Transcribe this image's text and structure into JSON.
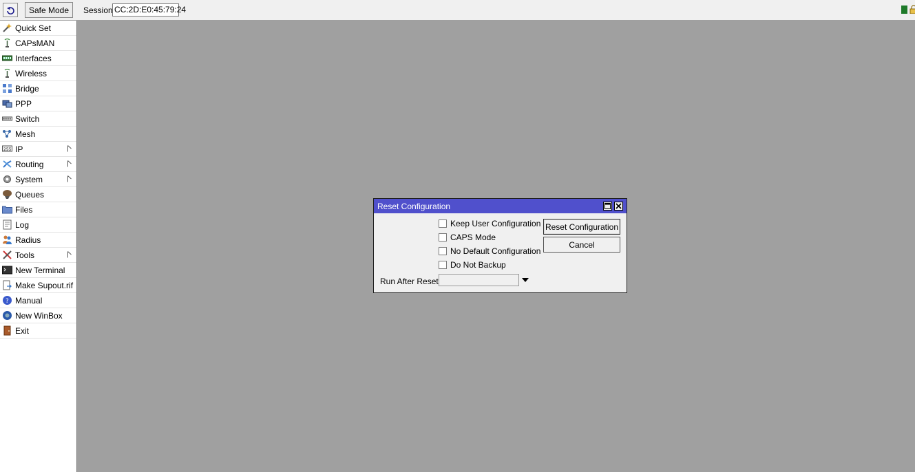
{
  "toolbar": {
    "safe_mode_label": "Safe Mode",
    "session_label": "Session:",
    "session_value": "CC:2D:E0:45:79:24"
  },
  "sidebar": {
    "items": [
      {
        "label": "Quick Set",
        "icon": "wand-icon"
      },
      {
        "label": "CAPsMAN",
        "icon": "antenna-icon"
      },
      {
        "label": "Interfaces",
        "icon": "ethernet-port-icon"
      },
      {
        "label": "Wireless",
        "icon": "antenna-icon"
      },
      {
        "label": "Bridge",
        "icon": "bridge-icon"
      },
      {
        "label": "PPP",
        "icon": "ppp-icon"
      },
      {
        "label": "Switch",
        "icon": "switch-icon"
      },
      {
        "label": "Mesh",
        "icon": "mesh-icon"
      },
      {
        "label": "IP",
        "icon": "ip-icon",
        "submenu": true
      },
      {
        "label": "Routing",
        "icon": "routing-icon",
        "submenu": true
      },
      {
        "label": "System",
        "icon": "gear-icon",
        "submenu": true
      },
      {
        "label": "Queues",
        "icon": "queue-icon"
      },
      {
        "label": "Files",
        "icon": "folder-icon"
      },
      {
        "label": "Log",
        "icon": "log-icon"
      },
      {
        "label": "Radius",
        "icon": "users-icon"
      },
      {
        "label": "Tools",
        "icon": "tools-icon",
        "submenu": true
      },
      {
        "label": "New Terminal",
        "icon": "terminal-icon"
      },
      {
        "label": "Make Supout.rif",
        "icon": "document-arrow-icon"
      },
      {
        "label": "Manual",
        "icon": "help-icon"
      },
      {
        "label": "New WinBox",
        "icon": "winbox-icon"
      },
      {
        "label": "Exit",
        "icon": "exit-door-icon"
      }
    ]
  },
  "dialog": {
    "title": "Reset Configuration",
    "checkboxes": [
      {
        "label": "Keep User Configuration",
        "checked": false
      },
      {
        "label": "CAPS Mode",
        "checked": false
      },
      {
        "label": "No Default Configuration",
        "checked": false
      },
      {
        "label": "Do Not Backup",
        "checked": false
      }
    ],
    "reset_button": "Reset Configuration",
    "cancel_button": "Cancel",
    "run_after_reset_label": "Run After Reset:",
    "run_after_reset_value": ""
  },
  "colors": {
    "title_bar": "#5050cc",
    "workspace": "#a0a0a0",
    "status_indicator": "#1e7a2a"
  }
}
